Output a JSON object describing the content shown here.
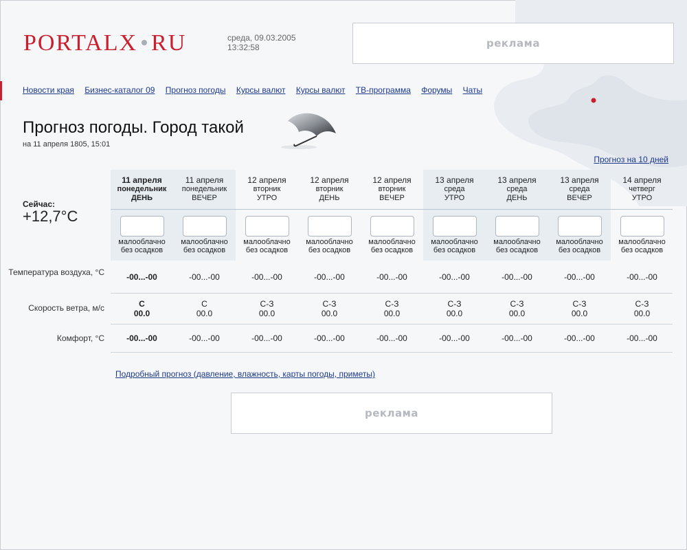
{
  "header": {
    "logo_left": "PORTALX",
    "logo_right": "RU",
    "date": "среда, 09.03.2005",
    "time": "13:32:58",
    "ad_label": "реклама"
  },
  "nav": [
    "Новости края",
    "Бизнес-каталог 09",
    "Прогноз погоды",
    "Курсы валют",
    "Курсы валют",
    "ТВ-программа",
    "Форумы",
    "Чаты"
  ],
  "page": {
    "title": "Прогноз погоды. Город такой",
    "subtitle": "на 11 апреля 1805, 15:01",
    "ten_days_link": "Прогноз на 10 дней",
    "now_label": "Сейчас:",
    "now_value": "+12,7°C"
  },
  "rows": {
    "temperature": "Температура воздуха, °С",
    "wind": "Скорость ветра, м/с",
    "comfort": "Комфорт, °С"
  },
  "columns": [
    {
      "date": "11 апреля",
      "weekday": "понедельник",
      "part": "ДЕНЬ",
      "desc1": "малооблачно",
      "desc2": "без осадков",
      "temp": "-00...-00",
      "wind_dir": "С",
      "wind_speed": "00.0",
      "comfort": "-00...-00"
    },
    {
      "date": "11 апреля",
      "weekday": "понедельник",
      "part": "ВЕЧЕР",
      "desc1": "малооблачно",
      "desc2": "без осадков",
      "temp": "-00...-00",
      "wind_dir": "С",
      "wind_speed": "00.0",
      "comfort": "-00...-00"
    },
    {
      "date": "12 апреля",
      "weekday": "вторник",
      "part": "УТРО",
      "desc1": "малооблачно",
      "desc2": "без осадков",
      "temp": "-00...-00",
      "wind_dir": "С-З",
      "wind_speed": "00.0",
      "comfort": "-00...-00"
    },
    {
      "date": "12 апреля",
      "weekday": "вторник",
      "part": "ДЕНЬ",
      "desc1": "малооблачно",
      "desc2": "без осадков",
      "temp": "-00...-00",
      "wind_dir": "С-З",
      "wind_speed": "00.0",
      "comfort": "-00...-00"
    },
    {
      "date": "12 апреля",
      "weekday": "вторник",
      "part": "ВЕЧЕР",
      "desc1": "малооблачно",
      "desc2": "без осадков",
      "temp": "-00...-00",
      "wind_dir": "С-З",
      "wind_speed": "00.0",
      "comfort": "-00...-00"
    },
    {
      "date": "13 апреля",
      "weekday": "среда",
      "part": "УТРО",
      "desc1": "малооблачно",
      "desc2": "без осадков",
      "temp": "-00...-00",
      "wind_dir": "С-З",
      "wind_speed": "00.0",
      "comfort": "-00...-00"
    },
    {
      "date": "13 апреля",
      "weekday": "среда",
      "part": "ДЕНЬ",
      "desc1": "малооблачно",
      "desc2": "без осадков",
      "temp": "-00...-00",
      "wind_dir": "С-З",
      "wind_speed": "00.0",
      "comfort": "-00...-00"
    },
    {
      "date": "13 апреля",
      "weekday": "среда",
      "part": "ВЕЧЕР",
      "desc1": "малооблачно",
      "desc2": "без осадков",
      "temp": "-00...-00",
      "wind_dir": "С-З",
      "wind_speed": "00.0",
      "comfort": "-00...-00"
    },
    {
      "date": "14 апреля",
      "weekday": "четверг",
      "part": "УТРО",
      "desc1": "малооблачно",
      "desc2": "без осадков",
      "temp": "-00...-00",
      "wind_dir": "С-З",
      "wind_speed": "00.0",
      "comfort": "-00...-00"
    }
  ],
  "detail_link": "Подробный прогноз (давление, влажность, карты погоды, приметы)",
  "colors": {
    "brand": "#c8202e",
    "link": "#1d3a8a",
    "highlight_column": "#e8edf2"
  },
  "icons": {
    "umbrella": "umbrella-icon",
    "map": "map-icon"
  }
}
